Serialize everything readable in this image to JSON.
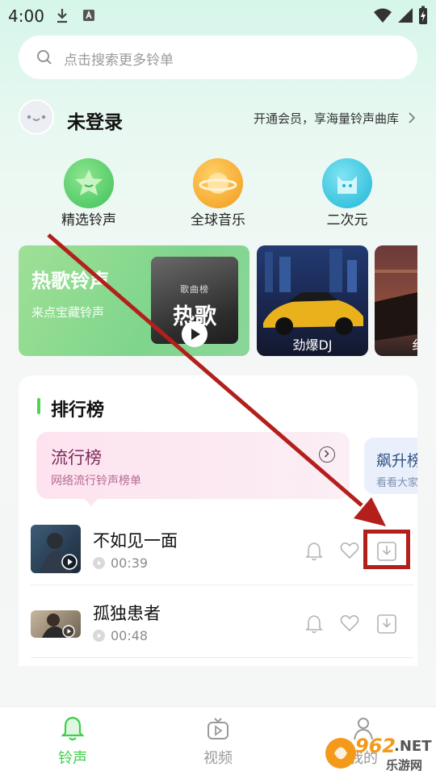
{
  "status_bar": {
    "time": "4:00"
  },
  "search": {
    "placeholder": "点击搜索更多铃单"
  },
  "user": {
    "name": "未登录",
    "vip_promo": "开通会员，享海量铃声曲库"
  },
  "categories": [
    {
      "label": "精选铃声",
      "icon": "star-icon",
      "color": "#5ed36a"
    },
    {
      "label": "全球音乐",
      "icon": "planet-icon",
      "color": "#f5a623"
    },
    {
      "label": "二次元",
      "icon": "cat-icon",
      "color": "#35c6e0"
    }
  ],
  "banners": {
    "hot": {
      "title": "热歌铃声",
      "subtitle": "来点宝藏铃声",
      "cover_small": "歌曲榜",
      "cover_title": "热歌"
    },
    "dj": {
      "label": "劲爆DJ"
    },
    "third": {
      "label_partial": "纟"
    }
  },
  "ranking": {
    "title": "排行榜",
    "popular": {
      "title": "流行榜",
      "subtitle": "网络流行铃声榜单"
    },
    "soaring": {
      "title": "飙升榜",
      "subtitle": "看看大家"
    }
  },
  "songs": [
    {
      "title": "不如见一面",
      "duration": "00:39"
    },
    {
      "title": "孤独患者",
      "duration": "00:48"
    }
  ],
  "nav": {
    "items": [
      {
        "label": "铃声",
        "icon": "bell-icon",
        "active": true
      },
      {
        "label": "视频",
        "icon": "video-icon",
        "active": false
      },
      {
        "label": "我的",
        "icon": "profile-icon",
        "active": false
      }
    ]
  },
  "watermark": {
    "brand": "962",
    "domain": ".NET",
    "site": "乐游网"
  },
  "colors": {
    "accent": "#4fd44f",
    "annotation": "#b3201c"
  }
}
